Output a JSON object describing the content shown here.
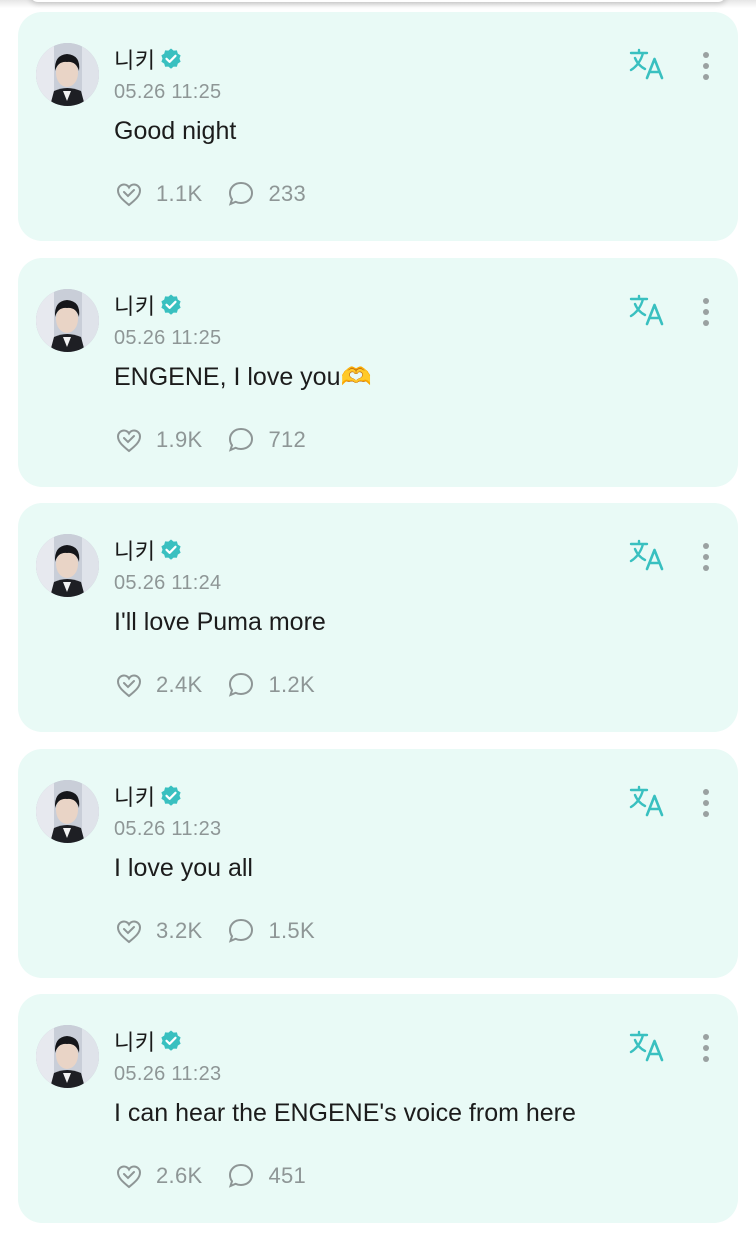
{
  "colors": {
    "card_background": "#e9faf6",
    "accent": "#39c0c0",
    "muted_text": "#8e9696",
    "primary_text": "#1c1c1c"
  },
  "icons": {
    "verified": "verified-check-icon",
    "translate": "translate-icon",
    "more": "more-vertical-icon",
    "like": "like-heart-icon",
    "comment": "comment-bubble-icon"
  },
  "posts": [
    {
      "author": "니키",
      "timestamp": "05.26 11:25",
      "text": "Good night",
      "likes": "1.1K",
      "comments": "233"
    },
    {
      "author": "니키",
      "timestamp": "05.26 11:25",
      "text": "ENGENE, I love you🫶",
      "likes": "1.9K",
      "comments": "712"
    },
    {
      "author": "니키",
      "timestamp": "05.26 11:24",
      "text": "I'll love Puma more",
      "likes": "2.4K",
      "comments": "1.2K"
    },
    {
      "author": "니키",
      "timestamp": "05.26 11:23",
      "text": "I love you all",
      "likes": "3.2K",
      "comments": "1.5K"
    },
    {
      "author": "니키",
      "timestamp": "05.26 11:23",
      "text": "I can hear the ENGENE's voice from here",
      "likes": "2.6K",
      "comments": "451"
    }
  ]
}
